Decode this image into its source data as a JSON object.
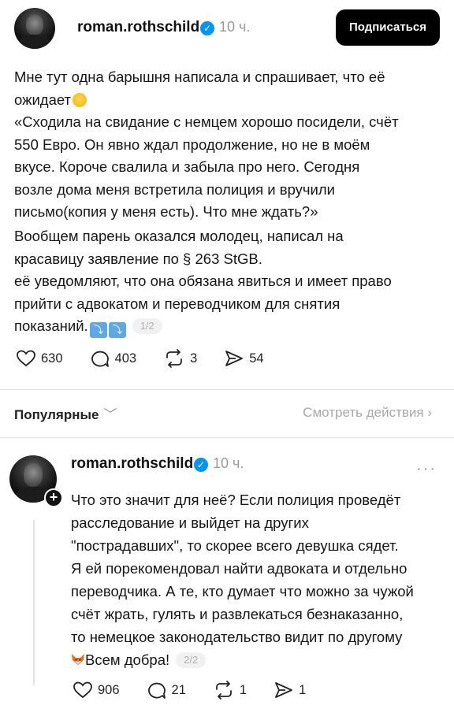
{
  "post1": {
    "username": "roman.rothschild",
    "time": "10 ч.",
    "subscribe_label": "Подписаться",
    "lines_a": [
      "Мне тут одна барышня написала и спрашивает, что её",
      "ожидает"
    ],
    "lines_b": [
      "«Сходила на свидание с немцем хорошо посидели, счёт",
      "550 Евро. Он явно ждал продолжение, но не в моём",
      "вкусе. Короче свалила и забыла про него. Сегодня",
      "возле дома меня встретила полиция и вручили",
      "письмо(копия у меня есть). Что мне ждать?»"
    ],
    "lines_c": [
      "Вообщем парень оказался молодец, написал на",
      "красавицу заявление по § 263 StGB.",
      "её уведомляют, что она обязана явиться и имеет право",
      "прийти с адвокатом и переводчиком для снятия",
      "показаний."
    ],
    "page_indicator": "1/2",
    "likes": "630",
    "comments": "403",
    "reposts": "3",
    "shares": "54"
  },
  "popular": {
    "label": "Популярные",
    "chevron": "﹀",
    "see_actions": "Смотреть действия ›"
  },
  "post2": {
    "username": "roman.rothschild",
    "time": "10 ч.",
    "more": "···",
    "plus": "+",
    "lines": [
      "Что это значит для неё? Если полиция проведёт",
      "расследование и выйдет на других",
      "\"пострадавших\", то скорее всего девушка сядет.",
      "Я ей порекомендовал найти адвоката и отдельно",
      "переводчика. А те, кто думает что можно за чужой",
      "счёт жрать, гулять и развлекаться безнаказанно,",
      "то немецкое законодательство видит по другому"
    ],
    "last_line": "Всем добра!",
    "page_indicator": "2/2",
    "likes": "906",
    "comments": "21",
    "reposts": "1",
    "shares": "1"
  },
  "colors": {
    "verified": "#0095f6",
    "subscribe_bg": "#000000",
    "muted": "#9a9a9a"
  }
}
